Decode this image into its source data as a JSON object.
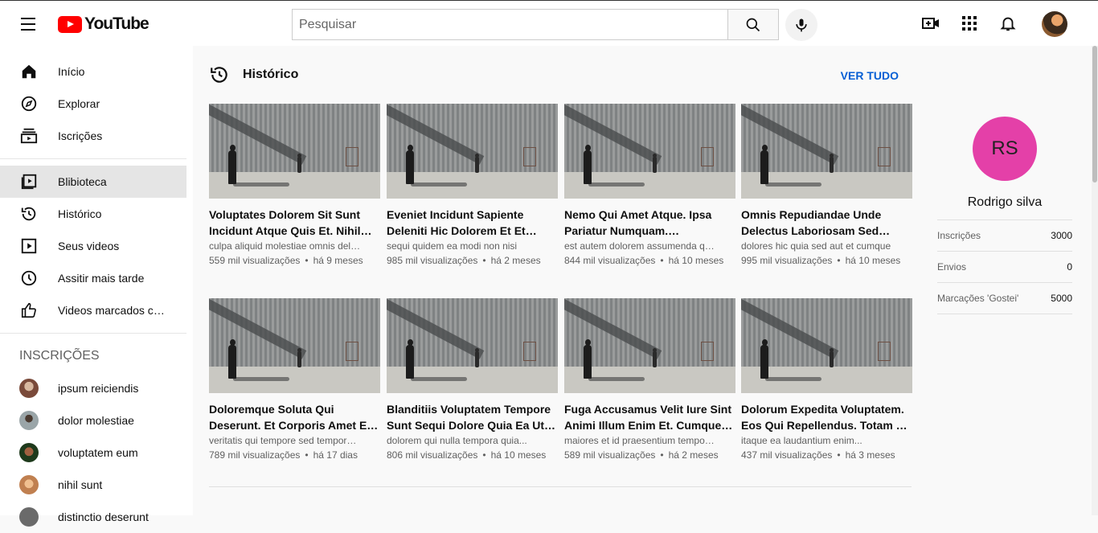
{
  "header": {
    "logo_text": "YouTube",
    "search_placeholder": "Pesquisar"
  },
  "sidebar": {
    "main_items": [
      {
        "label": "Início",
        "icon": "home-icon"
      },
      {
        "label": "Explorar",
        "icon": "compass-icon"
      },
      {
        "label": "Iscrições",
        "icon": "subscriptions-icon"
      }
    ],
    "library_items": [
      {
        "label": "Blibioteca",
        "icon": "library-icon",
        "active": true
      },
      {
        "label": "Histórico",
        "icon": "history-icon"
      },
      {
        "label": "Seus videos",
        "icon": "your-videos-icon"
      },
      {
        "label": "Assitir mais tarde",
        "icon": "watch-later-icon"
      },
      {
        "label": "Videos marcados como Gostei",
        "icon": "thumb-up-icon"
      }
    ],
    "subscriptions_heading": "INSCRIÇÕES",
    "subscriptions": [
      {
        "label": "ipsum reiciendis",
        "color": "#7a4a3a"
      },
      {
        "label": "dolor molestiae",
        "color": "#9aa5a8"
      },
      {
        "label": "voluptatem eum",
        "color": "#2c5a2a"
      },
      {
        "label": "nihil sunt",
        "color": "#d49b6a"
      },
      {
        "label": "distinctio deserunt",
        "color": "#6a6a6a"
      }
    ]
  },
  "history": {
    "title": "Histórico",
    "see_all": "VER TUDO",
    "videos": [
      {
        "title": "Voluptates Dolorem Sit Sunt Incidunt Atque Quis Et. Nihil Quisquam",
        "desc": "culpa aliquid molestiae omnis deleniti",
        "views": "559 mil visualizações",
        "age": "há 9 meses"
      },
      {
        "title": "Eveniet Incidunt Sapiente Deleniti Hic Dolorem Et Et Omnis Non. Aut",
        "desc": "sequi quidem ea modi non nisi",
        "views": "985 mil visualizações",
        "age": "há 2 meses"
      },
      {
        "title": "Nemo Qui Amet Atque. Ipsa Pariatur Numquam. Consequatur Vero",
        "desc": "est autem dolorem assumenda quia",
        "views": "844 mil visualizações",
        "age": "há 10 meses"
      },
      {
        "title": "Omnis Repudiandae Unde Delectus Laboriosam Sed Voluptatem",
        "desc": "dolores hic quia sed aut et cumque",
        "views": "995 mil visualizações",
        "age": "há 10 meses"
      },
      {
        "title": "Doloremque Soluta Qui Deserunt. Et Corporis Amet Et Debitis. Quia",
        "desc": "veritatis qui tempore sed tempora iusto",
        "views": "789 mil visualizações",
        "age": "há 17 dias"
      },
      {
        "title": "Blanditiis Voluptatem Tempore Sunt Sequi Dolore Quia Ea Ut Quis",
        "desc": "dolorem qui nulla tempora quia...",
        "views": "806 mil visualizações",
        "age": "há 10 meses"
      },
      {
        "title": "Fuga Accusamus Velit Iure Sint Animi Illum Enim Et. Cumque Et",
        "desc": "maiores et id praesentium tempore et",
        "views": "589 mil visualizações",
        "age": "há 2 meses"
      },
      {
        "title": "Dolorum Expedita Voluptatem. Eos Qui Repellendus. Totam Sit Aut",
        "desc": "itaque ea laudantium enim...",
        "views": "437 mil visualizações",
        "age": "há 3 meses"
      }
    ]
  },
  "profile": {
    "initials": "RS",
    "name": "Rodrigo silva",
    "avatar_color": "#e440a8",
    "stats": [
      {
        "label": "Inscrições",
        "value": "3000"
      },
      {
        "label": "Envios",
        "value": "0"
      },
      {
        "label": "Marcações 'Gostei'",
        "value": "5000"
      }
    ]
  }
}
